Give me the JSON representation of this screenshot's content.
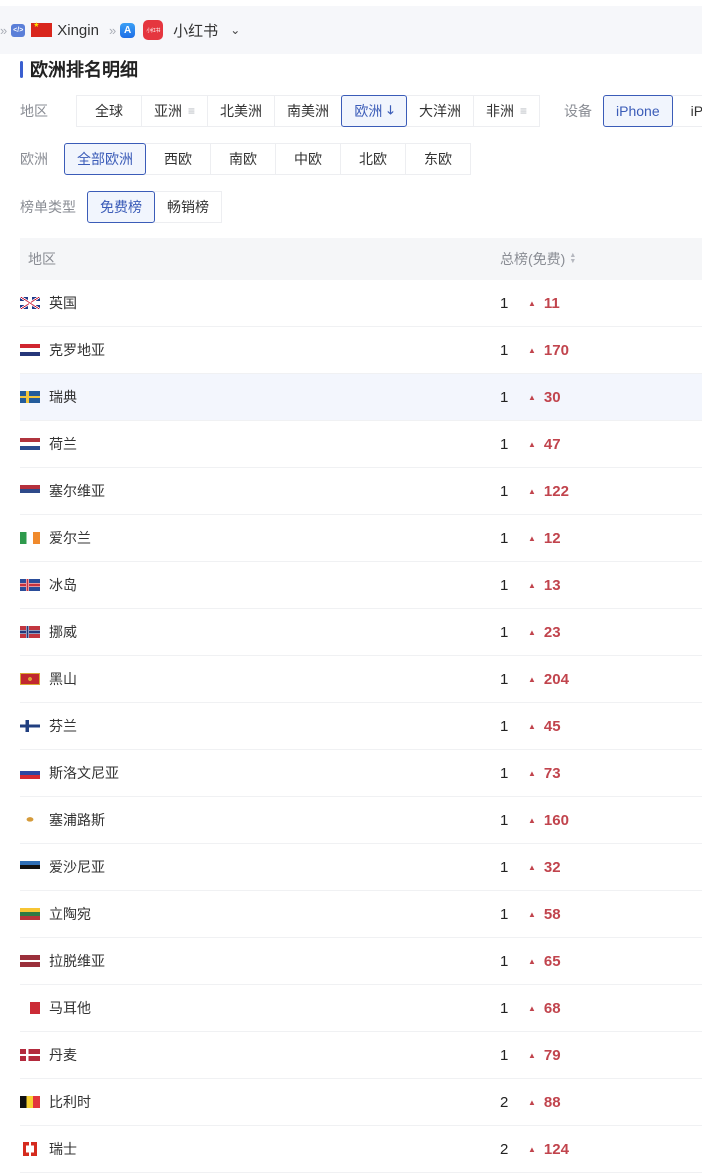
{
  "breadcrumb": {
    "developer": "Xingin",
    "developer_flag": "cn-flag",
    "app_name": "小红书",
    "app_icon_text": "小红书"
  },
  "section_title": "欧洲排名明细",
  "filters": {
    "region": {
      "label": "地区",
      "options": [
        {
          "label": "全球",
          "icon": null,
          "active": false
        },
        {
          "label": "亚洲",
          "icon": "menu-icon",
          "active": false
        },
        {
          "label": "北美洲",
          "icon": null,
          "active": false
        },
        {
          "label": "南美洲",
          "icon": null,
          "active": false
        },
        {
          "label": "欧洲",
          "icon": "arrow-down-icon",
          "active": true
        },
        {
          "label": "大洋洲",
          "icon": null,
          "active": false
        },
        {
          "label": "非洲",
          "icon": "menu-icon",
          "active": false
        }
      ]
    },
    "device": {
      "label": "设备",
      "options": [
        {
          "label": "iPhone",
          "active": true
        },
        {
          "label": "iPad",
          "active": false
        }
      ]
    },
    "subregion": {
      "label": "欧洲",
      "options": [
        {
          "label": "全部欧洲",
          "active": true
        },
        {
          "label": "西欧",
          "active": false
        },
        {
          "label": "南欧",
          "active": false
        },
        {
          "label": "中欧",
          "active": false
        },
        {
          "label": "北欧",
          "active": false
        },
        {
          "label": "东欧",
          "active": false
        }
      ]
    },
    "chart_type": {
      "label": "榜单类型",
      "options": [
        {
          "label": "免费榜",
          "active": true
        },
        {
          "label": "畅销榜",
          "active": false
        }
      ]
    }
  },
  "table": {
    "columns": {
      "region": "地区",
      "rank": "总榜(免费)"
    },
    "accent_color": "#c1444d",
    "rows": [
      {
        "country": "英国",
        "flag": "gb",
        "rank": "1",
        "change": "11"
      },
      {
        "country": "克罗地亚",
        "flag": "hr",
        "rank": "1",
        "change": "170"
      },
      {
        "country": "瑞典",
        "flag": "se",
        "rank": "1",
        "change": "30",
        "highlighted": true
      },
      {
        "country": "荷兰",
        "flag": "nl",
        "rank": "1",
        "change": "47"
      },
      {
        "country": "塞尔维亚",
        "flag": "rs",
        "rank": "1",
        "change": "122"
      },
      {
        "country": "爱尔兰",
        "flag": "ie",
        "rank": "1",
        "change": "12"
      },
      {
        "country": "冰岛",
        "flag": "is",
        "rank": "1",
        "change": "13"
      },
      {
        "country": "挪威",
        "flag": "no",
        "rank": "1",
        "change": "23"
      },
      {
        "country": "黑山",
        "flag": "me",
        "rank": "1",
        "change": "204"
      },
      {
        "country": "芬兰",
        "flag": "fi",
        "rank": "1",
        "change": "45"
      },
      {
        "country": "斯洛文尼亚",
        "flag": "si",
        "rank": "1",
        "change": "73"
      },
      {
        "country": "塞浦路斯",
        "flag": "cy",
        "rank": "1",
        "change": "160"
      },
      {
        "country": "爱沙尼亚",
        "flag": "ee",
        "rank": "1",
        "change": "32"
      },
      {
        "country": "立陶宛",
        "flag": "lt",
        "rank": "1",
        "change": "58"
      },
      {
        "country": "拉脱维亚",
        "flag": "lv",
        "rank": "1",
        "change": "65"
      },
      {
        "country": "马耳他",
        "flag": "mt",
        "rank": "1",
        "change": "68"
      },
      {
        "country": "丹麦",
        "flag": "dk",
        "rank": "1",
        "change": "79"
      },
      {
        "country": "比利时",
        "flag": "be",
        "rank": "2",
        "change": "88"
      },
      {
        "country": "瑞士",
        "flag": "ch",
        "rank": "2",
        "change": "124"
      }
    ]
  }
}
